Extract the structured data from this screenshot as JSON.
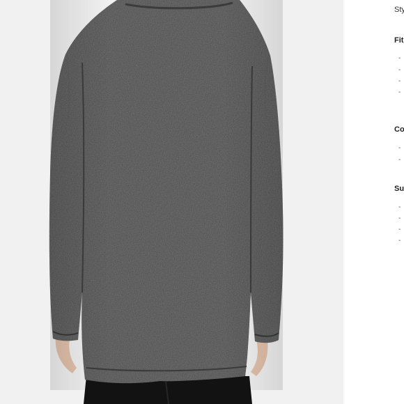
{
  "product_image": {
    "alt": "Back view of a model wearing a long dark charcoal heather knit cardigan with black trousers",
    "colors": {
      "sweater": "#454545",
      "sweater_shadow": "#353535",
      "background": "#f1f1f1",
      "trousers": "#121212",
      "skin": "#e4c4b0"
    }
  },
  "details": {
    "style_label": "Sty",
    "sections": [
      {
        "title": "Fit",
        "bullets": [
          "- ",
          "- ",
          "- ",
          "- "
        ]
      },
      {
        "title": "Co",
        "bullets": [
          "- ",
          "- "
        ]
      },
      {
        "title": "Su",
        "bullets": [
          "- ",
          "- ",
          "- ",
          "- "
        ]
      }
    ]
  }
}
